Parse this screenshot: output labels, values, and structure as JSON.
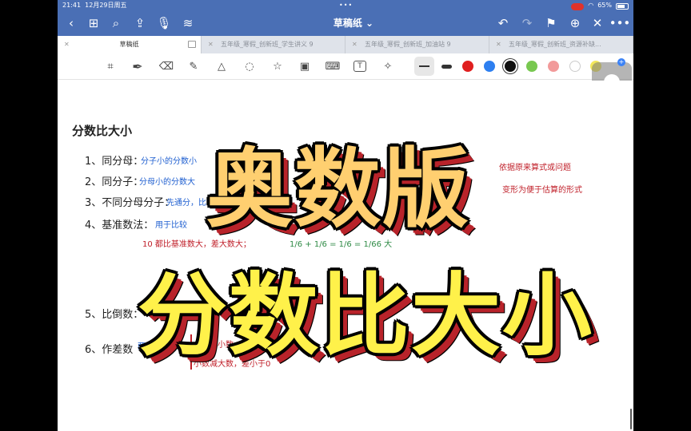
{
  "status": {
    "time": "21:41",
    "date": "12月29日周五",
    "dots": "•••",
    "battery": "65%"
  },
  "nav": {
    "back_icon": "chevron-left-icon",
    "title": "草稿纸 ⌄",
    "more": "•••"
  },
  "tabs": [
    {
      "label": "草稿纸",
      "active": true
    },
    {
      "label": "五年级_寒假_创新班_学生讲义 9",
      "active": false
    },
    {
      "label": "五年级_寒假_创新班_加油站 9",
      "active": false
    },
    {
      "label": "五年级_寒假_创新班_资源补缺...",
      "active": false
    }
  ],
  "toolbar": {
    "tools": [
      "lasso-icon",
      "pen-icon",
      "eraser-icon",
      "highlighter-icon",
      "shapes-icon",
      "lasso-select-icon",
      "sticker-icon",
      "image-icon",
      "keyboard-icon",
      "text-icon",
      "laser-icon"
    ],
    "text_tool_label": "T",
    "colors": [
      "#e01f1f",
      "#2d7ff0",
      "#111111",
      "#78c850",
      "#f29a9a",
      "#ffffff",
      "#f3e85a"
    ]
  },
  "notes": {
    "heading": "分数比大小",
    "item1": "1、同分母：",
    "item1_detail": "分子小的分数小",
    "item2": "2、同分子：",
    "item2_detail": "分母小的分数大",
    "item3": "3、不同分母分子：",
    "item3_detail": "先通分，比较",
    "item4": "4、基准数法：",
    "item4_detail": "用于比较",
    "sub4": "10 都比基准数大，差大数大；",
    "fraction": "1/6 + 1/6 = 1/6 = 1/66 大",
    "item5": "5、比倒数：",
    "item6": "6、作差数",
    "item6_detail": "两数作差",
    "item6_red1": "大数减小数，差大于0",
    "item6_red2": "小数减大数，差小于0",
    "right_note1": "依据原来算式或问题",
    "right_note2": "变形为便于估算的形式"
  },
  "overlay": {
    "top": "奥数版",
    "bottom": "分数比大小"
  }
}
